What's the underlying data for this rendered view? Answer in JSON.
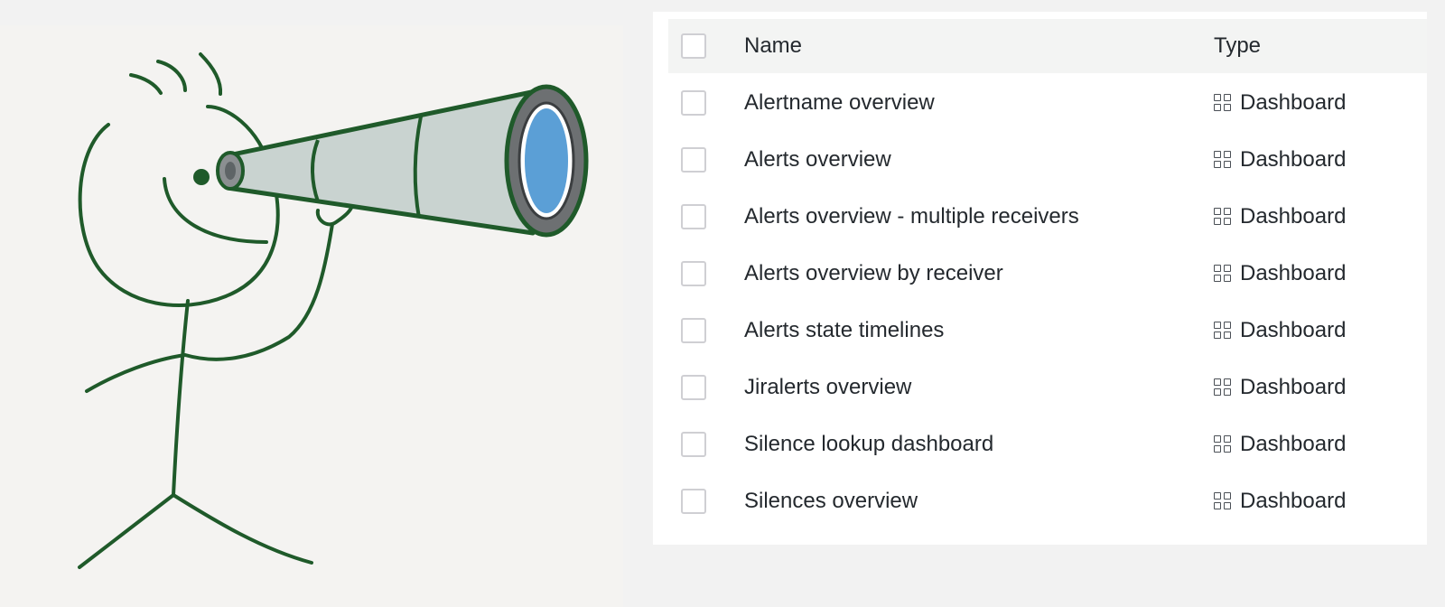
{
  "table": {
    "columns": {
      "name": "Name",
      "type": "Type"
    },
    "rows": [
      {
        "name": "Alertname overview",
        "type": "Dashboard"
      },
      {
        "name": "Alerts overview",
        "type": "Dashboard"
      },
      {
        "name": "Alerts overview - multiple receivers",
        "type": "Dashboard"
      },
      {
        "name": "Alerts overview by receiver",
        "type": "Dashboard"
      },
      {
        "name": "Alerts state timelines",
        "type": "Dashboard"
      },
      {
        "name": "Jiralerts overview",
        "type": "Dashboard"
      },
      {
        "name": "Silence lookup dashboard",
        "type": "Dashboard"
      },
      {
        "name": "Silences overview",
        "type": "Dashboard"
      }
    ],
    "type_icon": "dashboard-grid-icon"
  },
  "illustration": {
    "subject": "stick-figure-with-telescope"
  },
  "colors": {
    "page_bg": "#f2f2f2",
    "illustration_bg": "#f4f3f1",
    "line": "#1f5a2a",
    "telescope_body": "#c9d3d0",
    "lens": "#5b9fd6",
    "text": "#24292e"
  }
}
